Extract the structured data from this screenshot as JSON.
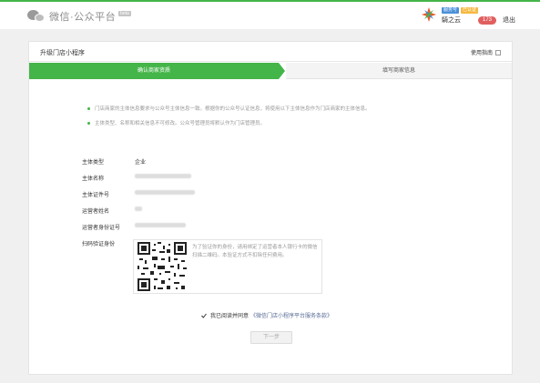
{
  "header": {
    "logo_text": "微信·公众平台",
    "beta_label": "beta",
    "user": {
      "tag_verified": "服务号",
      "tag_type": "已认证",
      "name": "騎之云"
    },
    "message_count": "173",
    "logout": "退出"
  },
  "card": {
    "title": "升级门店小程序",
    "guide": "使用指南",
    "steps": [
      {
        "label": "确认商家资质",
        "active": true
      },
      {
        "label": "填写商家信息",
        "active": false
      }
    ],
    "tips": [
      "门店商家的主体信息要求与公众号主体信息一致。根据你的公众号认证信息，将使用以下主体信息作为门店商家的主体信息。",
      "主体类型、名称和相关信息不可修改。公众号管理员将默认作为门店管理员。"
    ],
    "fields": [
      {
        "label": "主体类型",
        "value": "企业"
      },
      {
        "label": "主体名称",
        "value": ""
      },
      {
        "label": "主体证件号",
        "value": ""
      },
      {
        "label": "运营者姓名",
        "value": "",
        "blur_width": 8
      },
      {
        "label": "运营者身份证号",
        "value": ""
      },
      {
        "label": "扫码验证身份",
        "value": ""
      }
    ],
    "qr_text": "为了验证你的身份，请用绑定了运营者本人银行卡的微信扫描二维码。本验证方式不扣除任何费用。",
    "agree_text": "我已阅读并同意",
    "agree_link": "《微信门店小程序平台服务条款》",
    "next_button": "下一步"
  },
  "colors": {
    "brand_green": "#44b549",
    "link_blue": "#576b95",
    "badge_red": "#e15f5f"
  }
}
